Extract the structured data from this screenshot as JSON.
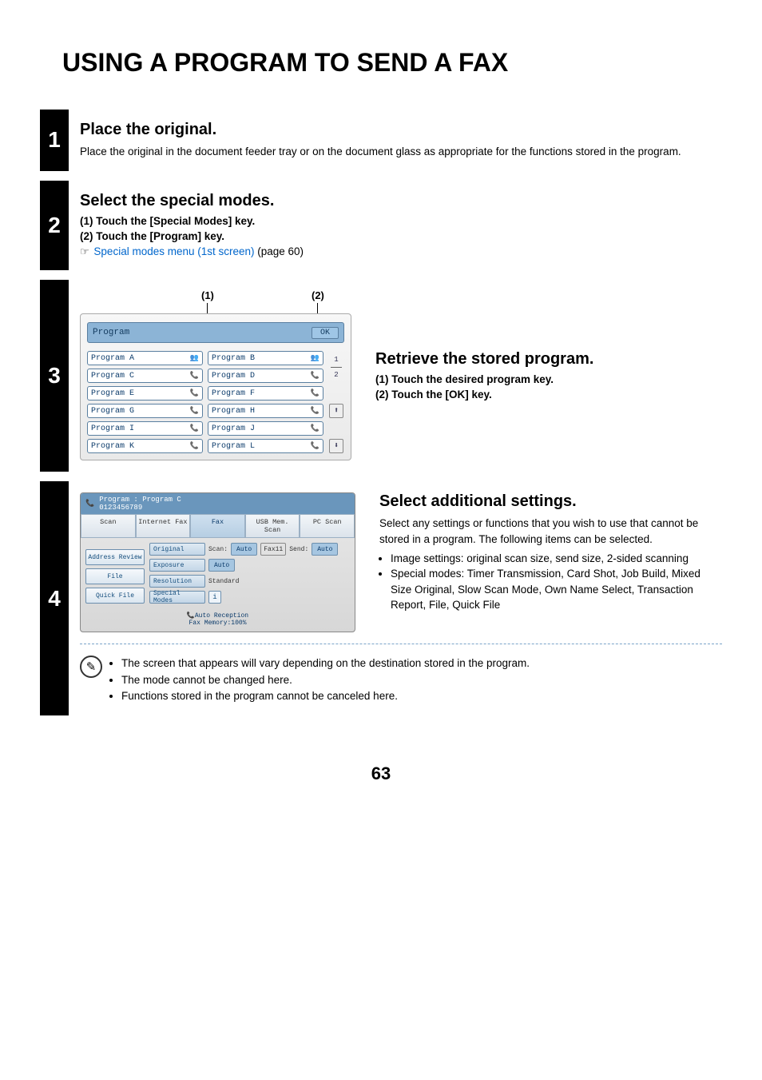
{
  "title": "USING A PROGRAM TO SEND A FAX",
  "page_number": "63",
  "steps": {
    "s1": {
      "num": "1",
      "heading": "Place the original.",
      "text": "Place the original in the document feeder tray or on the document glass as appropriate for the functions stored in the program."
    },
    "s2": {
      "num": "2",
      "heading": "Select the special modes.",
      "sub1": "(1)   Touch the [Special Modes] key.",
      "sub2": "(2)   Touch the [Program] key.",
      "link": "Special modes menu (1st screen)",
      "link_suffix": " (page 60)",
      "hand": "☞"
    },
    "s3": {
      "num": "3",
      "heading": "Retrieve the stored program.",
      "sub1": "(1)   Touch the desired program key.",
      "sub2": "(2)   Touch the [OK] key.",
      "callout1": "(1)",
      "callout2": "(2)",
      "panel": {
        "title": "Program",
        "ok": "OK",
        "page_indicator_1": "1",
        "page_indicator_2": "2",
        "arrow_up": "⬆",
        "arrow_down": "⬇",
        "items": [
          {
            "l": "Program A",
            "li": "👥",
            "r": "Program B",
            "ri": "👥"
          },
          {
            "l": "Program C",
            "li": "📞",
            "r": "Program D",
            "ri": "📞"
          },
          {
            "l": "Program E",
            "li": "📞",
            "r": "Program F",
            "ri": "📞"
          },
          {
            "l": "Program G",
            "li": "📞",
            "r": "Program H",
            "ri": "📞"
          },
          {
            "l": "Program I",
            "li": "📞",
            "r": "Program J",
            "ri": "📞"
          },
          {
            "l": "Program K",
            "li": "📞",
            "r": "Program L",
            "ri": "📞"
          }
        ]
      }
    },
    "s4": {
      "num": "4",
      "heading": "Select additional settings.",
      "intro": "Select any settings or functions that you wish to use that cannot be stored in a program. The following items can be selected.",
      "li1": "Image settings: original scan size, send size, 2-sided scanning",
      "li2": "Special modes: Timer Transmission, Card Shot, Job Build, Mixed Size Original, Slow Scan Mode, Own Name Select, Transaction Report, File, Quick File",
      "notes": [
        "The screen that appears will vary depending on the destination stored in the program.",
        "The mode cannot be changed here.",
        "Functions stored in the program cannot be canceled here."
      ],
      "panel": {
        "top_icon": "📞",
        "top1": "Program : Program C",
        "top2": "0123456789",
        "tabs": [
          "Scan",
          "Internet Fax",
          "Fax",
          "USB Mem. Scan",
          "PC Scan"
        ],
        "active_tab": 2,
        "left": [
          "Address Review",
          "File",
          "Quick File"
        ],
        "rows": {
          "original": "Original",
          "scan_lbl": "Scan:",
          "scan_val": "Auto",
          "fax11": "Fax11",
          "send_lbl": "Send:",
          "send_val": "Auto",
          "exposure": "Exposure",
          "exposure_val": "Auto",
          "resolution": "Resolution",
          "resolution_val": "Standard",
          "special": "Special Modes",
          "info": "i"
        },
        "footer1": "Auto Reception",
        "footer1_icon": "📞",
        "footer2": "Fax Memory:100%"
      }
    }
  }
}
